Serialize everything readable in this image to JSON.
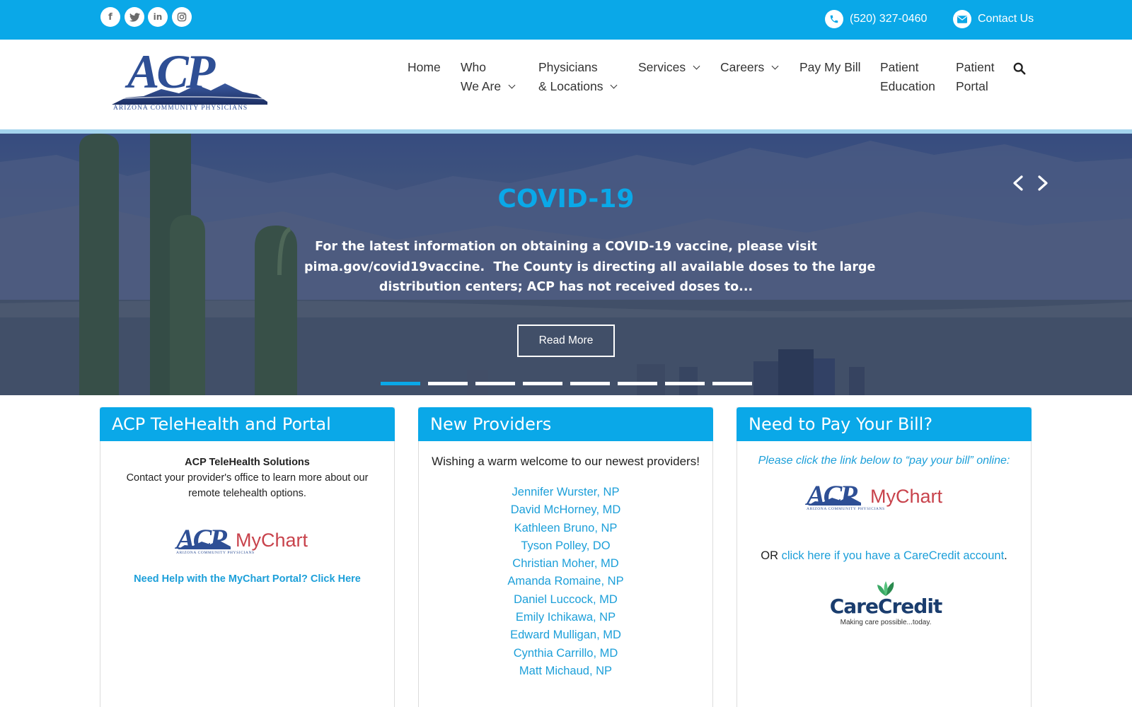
{
  "topbar": {
    "social": [
      {
        "name": "facebook-icon",
        "glyph": "f"
      },
      {
        "name": "twitter-icon",
        "glyph": "t"
      },
      {
        "name": "linkedin-icon",
        "glyph": "in"
      },
      {
        "name": "instagram-icon",
        "glyph": "ig"
      }
    ],
    "phone": "(520) 327-0460",
    "contact": "Contact Us"
  },
  "logo": {
    "text": "ACP",
    "subtitle": "ARIZONA COMMUNITY PHYSICIANS"
  },
  "nav": {
    "home": "Home",
    "who_1": "Who",
    "who_2": "We Are",
    "phys_1": "Physicians",
    "phys_2": "& Locations",
    "services": "Services",
    "careers": "Careers",
    "pay": "Pay My Bill",
    "edu_1": "Patient",
    "edu_2": "Education",
    "portal_1": "Patient",
    "portal_2": "Portal"
  },
  "hero": {
    "title": "COVID-19",
    "line1": "For the latest information on obtaining a COVID-19 vaccine, please visit",
    "line2": "pima.gov/covid19vaccine.  The County is directing all available doses to the large",
    "line3": "distribution centers; ACP has not received doses to...",
    "button": "Read More",
    "slide_count": 8,
    "active_slide": 1
  },
  "cards": {
    "telehealth": {
      "title": "ACP TeleHealth and Portal",
      "heading": "ACP TeleHealth Solutions",
      "text1": "Contact your provider's office to learn more about our",
      "text2": "remote telehealth options.",
      "help_link": "Need Help with the MyChart Portal? Click Here"
    },
    "providers": {
      "title": "New Providers",
      "intro": "Wishing a warm welcome to our newest providers!",
      "list": [
        "Jennifer Wurster, NP",
        "David McHorney, MD",
        "Kathleen Bruno, NP",
        "Tyson Polley, DO",
        "Christian Moher, MD",
        "Amanda Romaine, NP",
        "Daniel Luccock, MD",
        "Emily Ichikawa, NP",
        "Edward Mulligan, MD",
        "Cynthia Carrillo, MD",
        "Matt Michaud, NP"
      ]
    },
    "bill": {
      "title": "Need to Pay Your Bill?",
      "instruction": "Please click the link below to “pay your bill” online:",
      "or": "OR ",
      "carecredit_link": "click here if you have a CareCredit account",
      "period": ".",
      "carecredit_logo": "CareCredit",
      "carecredit_tagline": "Making care possible...today."
    }
  },
  "mychart": {
    "acp": "ACP",
    "my": "MyChart",
    "sub": "ARIZONA COMMUNITY PHYSICIANS"
  },
  "colors": {
    "accent": "#0aa8e8",
    "link": "#1c9fd9",
    "logo_blue": "#2e4f95",
    "mychart_red": "#c8434c"
  }
}
